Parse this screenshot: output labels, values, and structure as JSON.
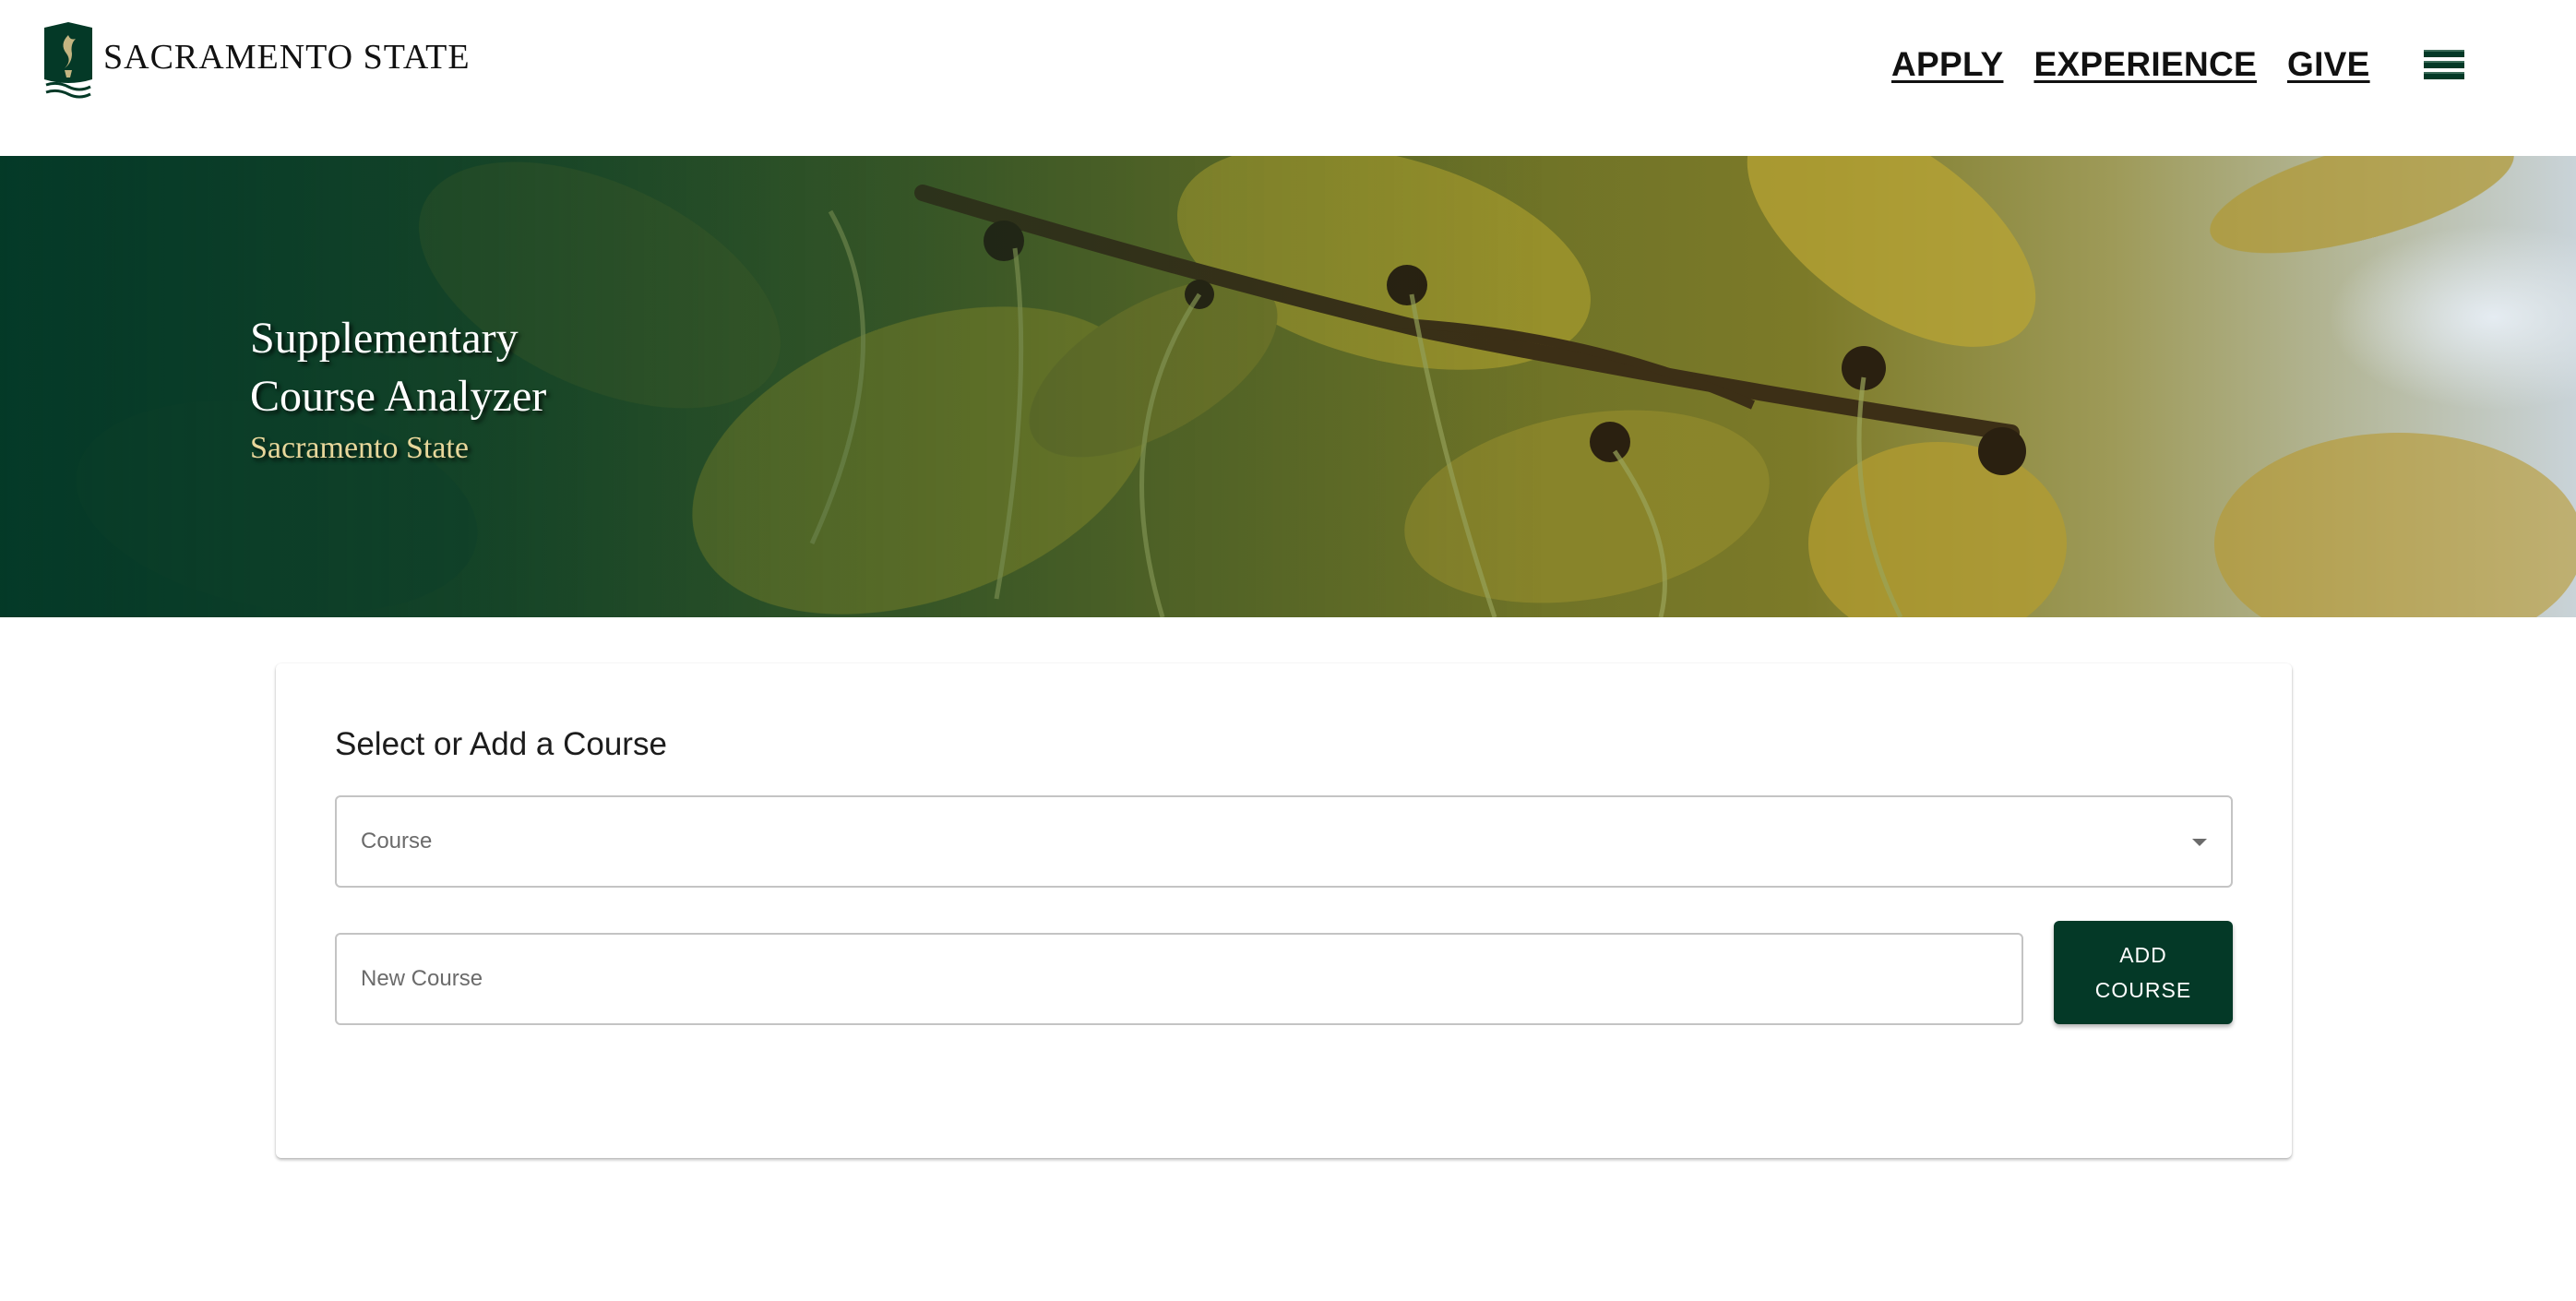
{
  "header": {
    "brand_name": "SACRAMENTO STATE",
    "nav": {
      "apply": "APPLY",
      "experience": "EXPERIENCE",
      "give": "GIVE"
    },
    "menu_icon": "hamburger-menu-icon"
  },
  "hero": {
    "title": "Supplementary Course Analyzer",
    "subtitle": "Sacramento State"
  },
  "course_form": {
    "heading": "Select or Add a Course",
    "course_select_label": "Course",
    "new_course_placeholder": "New Course",
    "add_button_label": "ADD COURSE"
  },
  "colors": {
    "brand_green": "#043927",
    "brand_gold": "#e7d79b"
  }
}
